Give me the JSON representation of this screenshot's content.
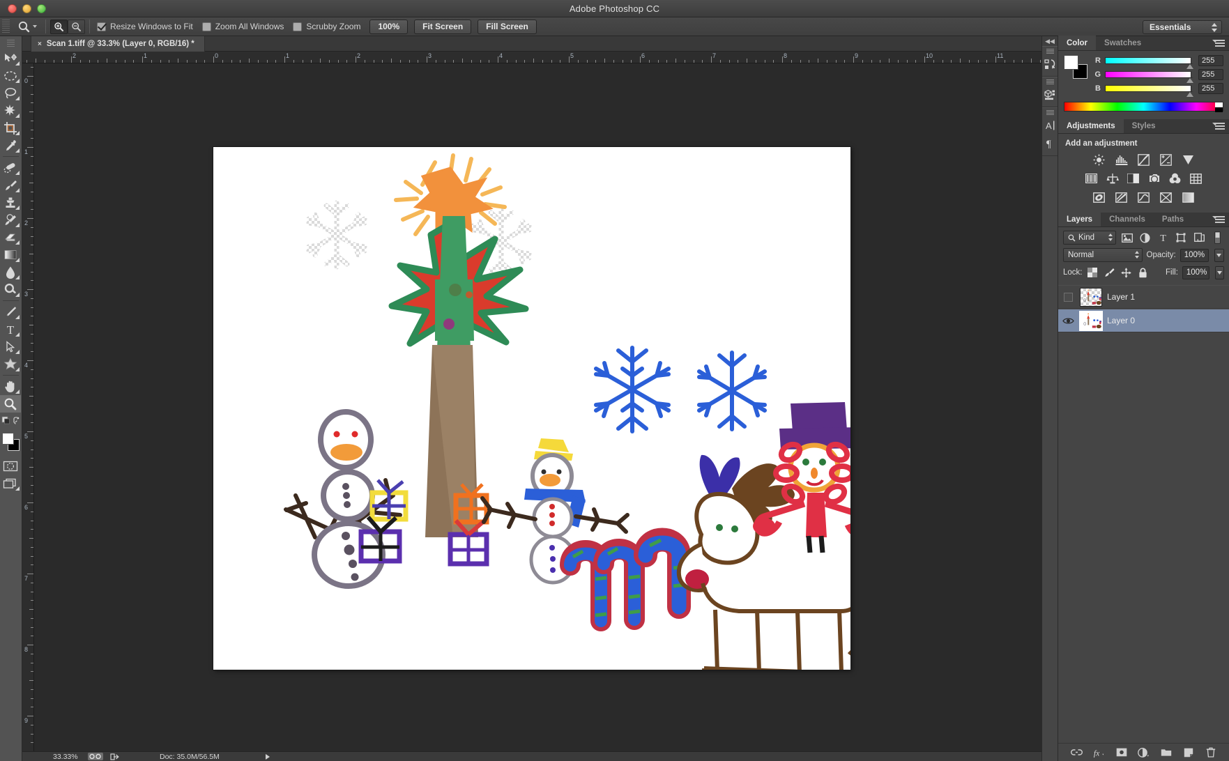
{
  "window": {
    "title": "Adobe Photoshop CC"
  },
  "options_bar": {
    "tool_preset_icon": "zoom-tool-icon",
    "zoom_in_icon": "zoom-in-icon",
    "zoom_out_icon": "zoom-out-icon",
    "checkboxes": [
      {
        "label": "Resize Windows to Fit",
        "checked": true
      },
      {
        "label": "Zoom All Windows",
        "checked": false
      },
      {
        "label": "Scrubby Zoom",
        "checked": false
      }
    ],
    "buttons": [
      {
        "label": "100%"
      },
      {
        "label": "Fit Screen"
      },
      {
        "label": "Fill Screen"
      }
    ],
    "workspace": "Essentials"
  },
  "document": {
    "tab_label": "Scan 1.tiff @ 33.3% (Layer 0, RGB/16) *",
    "close_glyph": "×"
  },
  "rulers": {
    "unit": "inches",
    "horizontal_labels": [
      "1",
      "2",
      "3",
      "4",
      "5",
      "6",
      "7",
      "8",
      "9",
      "10",
      "11"
    ],
    "vertical_labels": [
      "1",
      "0",
      "1",
      "2",
      "3",
      "4",
      "5",
      "6",
      "7",
      "8"
    ]
  },
  "toolbar": {
    "tools": [
      {
        "name": "move-tool",
        "glyph": "move"
      },
      {
        "name": "marquee-tool",
        "glyph": "marquee"
      },
      {
        "name": "lasso-tool",
        "glyph": "lasso"
      },
      {
        "name": "magic-wand-tool",
        "glyph": "wand"
      },
      {
        "name": "crop-tool",
        "glyph": "crop"
      },
      {
        "name": "eyedropper-tool",
        "glyph": "eyedropper"
      },
      {
        "name": "spot-healing-brush-tool",
        "glyph": "healing"
      },
      {
        "name": "brush-tool",
        "glyph": "brush"
      },
      {
        "name": "clone-stamp-tool",
        "glyph": "stamp"
      },
      {
        "name": "history-brush-tool",
        "glyph": "historybrush"
      },
      {
        "name": "eraser-tool",
        "glyph": "eraser"
      },
      {
        "name": "gradient-tool",
        "glyph": "gradient"
      },
      {
        "name": "blur-tool",
        "glyph": "blur"
      },
      {
        "name": "dodge-tool",
        "glyph": "dodge"
      },
      {
        "name": "pen-tool",
        "glyph": "pen"
      },
      {
        "name": "type-tool",
        "glyph": "type"
      },
      {
        "name": "path-selection-tool",
        "glyph": "pathselect"
      },
      {
        "name": "custom-shape-tool",
        "glyph": "shape"
      },
      {
        "name": "hand-tool",
        "glyph": "hand"
      },
      {
        "name": "zoom-tool",
        "glyph": "zoom",
        "selected": true
      }
    ],
    "foreground_color": "#ffffff",
    "background_color": "#000000",
    "quick-mask": "quick-mask-icon",
    "screen-mode": "screen-mode-icon"
  },
  "icon_rail": {
    "collapse_glyph": "◀◀",
    "items": [
      {
        "name": "history-panel-icon"
      },
      {
        "name": "3d-panel-icon"
      },
      {
        "name": "character-panel-icon"
      },
      {
        "name": "paragraph-panel-icon"
      }
    ]
  },
  "color_panel": {
    "tabs": [
      {
        "label": "Color",
        "active": true
      },
      {
        "label": "Swatches",
        "active": false
      }
    ],
    "channels": [
      {
        "label": "R",
        "value": "255",
        "from": "#00ffff",
        "to": "#ffffff"
      },
      {
        "label": "G",
        "value": "255",
        "from": "#ff00ff",
        "to": "#ffffff"
      },
      {
        "label": "B",
        "value": "255",
        "from": "#ffff00",
        "to": "#ffffff"
      }
    ],
    "foreground": "#ffffff",
    "background": "#000000"
  },
  "adjustments_panel": {
    "tabs": [
      {
        "label": "Adjustments",
        "active": true
      },
      {
        "label": "Styles",
        "active": false
      }
    ],
    "heading": "Add an adjustment",
    "rows": [
      [
        "brightness-contrast-icon",
        "levels-icon",
        "curves-icon",
        "exposure-icon",
        "vibrance-icon"
      ],
      [
        "hue-saturation-icon",
        "color-balance-icon",
        "black-white-icon",
        "photo-filter-icon",
        "channel-mixer-icon",
        "color-lookup-icon"
      ],
      [
        "invert-icon",
        "posterize-icon",
        "threshold-icon",
        "gradient-map-icon",
        "selective-color-icon"
      ]
    ]
  },
  "layers_panel": {
    "tabs": [
      {
        "label": "Layers",
        "active": true
      },
      {
        "label": "Channels",
        "active": false
      },
      {
        "label": "Paths",
        "active": false
      }
    ],
    "filter_label": "Kind",
    "filter_icons": [
      "pixel-filter-icon",
      "adjustment-filter-icon",
      "type-filter-icon",
      "shape-filter-icon",
      "smartobject-filter-icon",
      "filter-toggle-icon"
    ],
    "blend_mode": "Normal",
    "opacity_label": "Opacity:",
    "opacity_value": "100%",
    "lock_label": "Lock:",
    "lock_icons": [
      "lock-transparency-icon",
      "lock-image-icon",
      "lock-position-icon",
      "lock-all-icon"
    ],
    "fill_label": "Fill:",
    "fill_value": "100%",
    "layers": [
      {
        "name": "Layer 1",
        "visible": false,
        "selected": false,
        "thumb": "transparent"
      },
      {
        "name": "Layer 0",
        "visible": true,
        "selected": true,
        "thumb": "white"
      }
    ],
    "footer_icons": [
      "link-layers-icon",
      "layer-style-fx-icon",
      "add-mask-icon",
      "new-fill-adjustment-icon",
      "new-group-icon",
      "new-layer-icon",
      "delete-layer-icon"
    ]
  },
  "status_bar": {
    "zoom": "33.33%",
    "doc_info": "Doc: 35.0M/56.5M",
    "icons": [
      "camera-raw-icon",
      "share-icon"
    ],
    "arrow_glyph": "▶"
  },
  "artwork": {
    "description": "Child's marker drawing of a winter/Christmas scene",
    "elements": [
      "erased-snowflake-top-left",
      "erased-snowflake-top-center",
      "snowman-grey-left",
      "christmas-tree-with-orange-star",
      "snowman-yellow-hat-blue-scarf",
      "blue-snowflake-left",
      "blue-snowflake-right",
      "candy-cane-1",
      "candy-cane-2",
      "candy-cane-3",
      "reindeer-brown",
      "clown-red-purple-hat",
      "gift-yellow",
      "gift-orange",
      "gift-purple",
      "gift-red-purple"
    ]
  }
}
